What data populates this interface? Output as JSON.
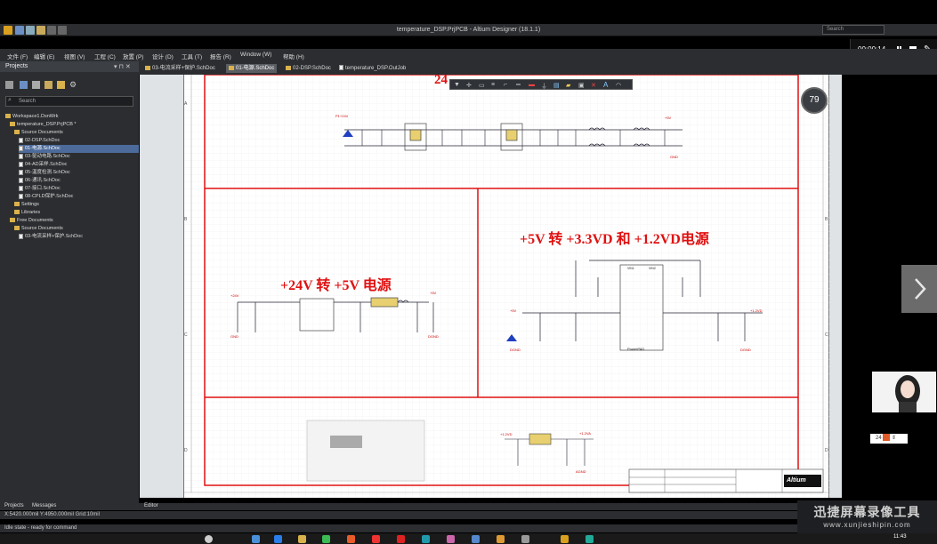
{
  "window": {
    "title": "temperature_DSP.PrjPCB - Altium Designer (18.1.1)",
    "search_placeholder": "Search"
  },
  "recorder": {
    "time": "00:00:14"
  },
  "menu": [
    "文件 (F)",
    "编辑 (E)",
    "视图 (V)",
    "工程 (C)",
    "放置 (P)",
    "设计 (D)",
    "工具 (T)",
    "报告 (R)",
    "Window (W)",
    "帮助 (H)"
  ],
  "panel": {
    "title": "Projects",
    "search_placeholder": "Search",
    "tree": [
      {
        "label": "Workspace1.DsnWrk",
        "indent": 0,
        "kind": "ws"
      },
      {
        "label": "temperature_DSP.PrjPCB *",
        "indent": 1,
        "kind": "proj"
      },
      {
        "label": "Source Documents",
        "indent": 2,
        "kind": "folder"
      },
      {
        "label": "02-DSP.SchDoc",
        "indent": 3,
        "kind": "doc"
      },
      {
        "label": "01-电源.SchDoc",
        "indent": 3,
        "kind": "doc",
        "selected": true
      },
      {
        "label": "03-驱动电路.SchDoc",
        "indent": 3,
        "kind": "doc"
      },
      {
        "label": "04-AD采样.SchDoc",
        "indent": 3,
        "kind": "doc"
      },
      {
        "label": "05-温度检测.SchDoc",
        "indent": 3,
        "kind": "doc"
      },
      {
        "label": "06-通讯.SchDoc",
        "indent": 3,
        "kind": "doc"
      },
      {
        "label": "07-接口.SchDoc",
        "indent": 3,
        "kind": "doc"
      },
      {
        "label": "08-CPLD保护.SchDoc",
        "indent": 3,
        "kind": "doc"
      },
      {
        "label": "Settings",
        "indent": 2,
        "kind": "folder"
      },
      {
        "label": "Libraries",
        "indent": 2,
        "kind": "folder"
      },
      {
        "label": "Free Documents",
        "indent": 1,
        "kind": "proj"
      },
      {
        "label": "Source Documents",
        "indent": 2,
        "kind": "folder"
      },
      {
        "label": "03-电流采样+保护.SchDoc",
        "indent": 3,
        "kind": "doc"
      }
    ]
  },
  "doc_tabs": [
    {
      "label": "03-电流采样+保护.SchDoc",
      "active": false
    },
    {
      "label": "01-电源.SchDoc",
      "active": true
    },
    {
      "label": "02-DSP.SchDoc",
      "active": false
    },
    {
      "label": "temperature_DSP.OutJob",
      "active": false
    }
  ],
  "schematic": {
    "top_title": "24",
    "section_24v_5v": "+24V 转 +5V 电源",
    "section_5v_33": "+5V 转 +3.3VD 和 +1.2VD电源",
    "chip_label": "PowerPAD",
    "logo": "Altium"
  },
  "zoom_badge": "79",
  "bottom_tabs": [
    "Projects",
    "Messages"
  ],
  "editor_tab": "Editor",
  "coords": "X:5420.000mil Y:4950.000mil   Grid:10mil",
  "status": "Idle state - ready for command",
  "taskbar_time": "11:43",
  "watermark": {
    "cn": "迅捷屏幕录像工具",
    "url": "www.xunjieshipin.com"
  },
  "mini_ctl": "24"
}
